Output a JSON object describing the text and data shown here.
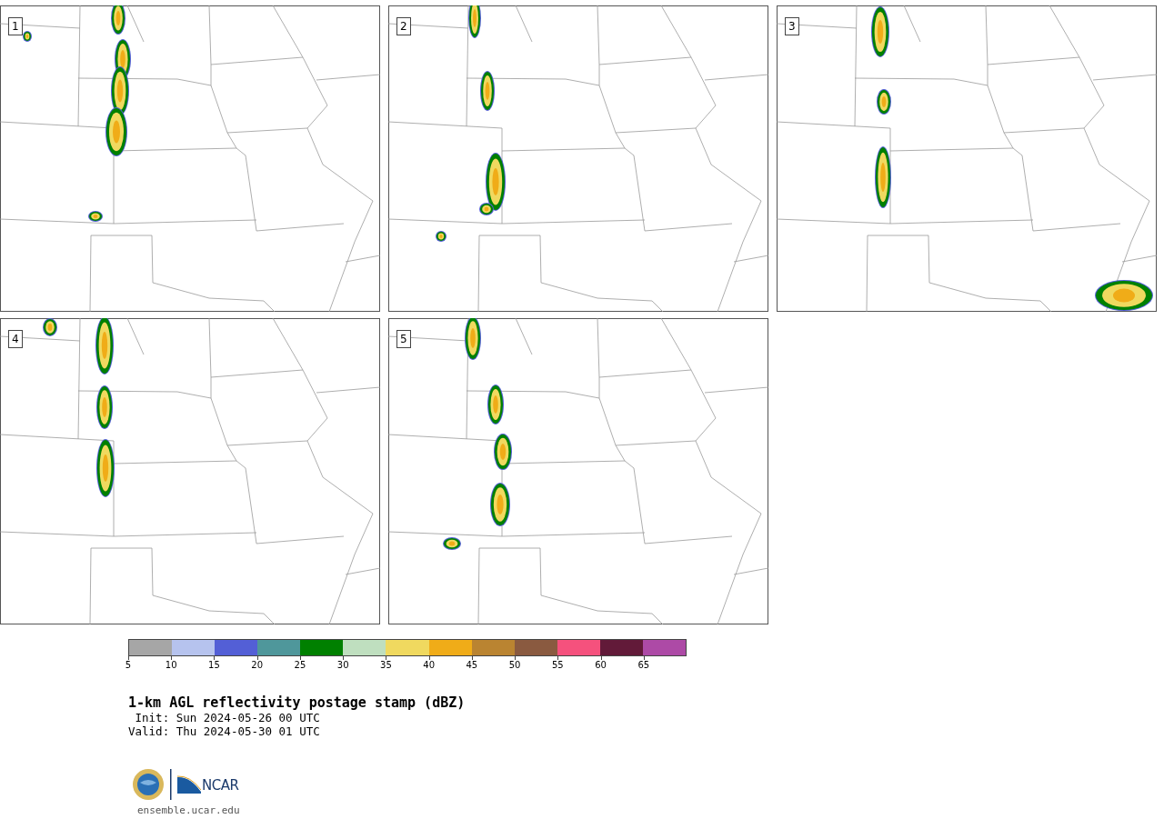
{
  "panels": [
    {
      "label": "1"
    },
    {
      "label": "2"
    },
    {
      "label": "3"
    },
    {
      "label": "4"
    },
    {
      "label": "5"
    }
  ],
  "colorbar": {
    "bins": [
      {
        "color": "#a6a6a6"
      },
      {
        "color": "#b6c3ee"
      },
      {
        "color": "#535fd6"
      },
      {
        "color": "#4f979b"
      },
      {
        "color": "#008000"
      },
      {
        "color": "#bfdfbf"
      },
      {
        "color": "#f0d95f"
      },
      {
        "color": "#f0ac18"
      },
      {
        "color": "#ba8431"
      },
      {
        "color": "#8a5a40"
      },
      {
        "color": "#f5517d"
      },
      {
        "color": "#621a39"
      },
      {
        "color": "#ad4aa6"
      }
    ],
    "ticks": [
      "5",
      "10",
      "15",
      "20",
      "25",
      "30",
      "35",
      "40",
      "45",
      "50",
      "55",
      "60",
      "65"
    ]
  },
  "title": "1-km AGL reflectivity postage stamp (dBZ)",
  "init": " Init: Sun 2024-05-26 00 UTC",
  "valid": "Valid: Thu 2024-05-30 01 UTC",
  "logo": {
    "text": "NCAR"
  },
  "url": "ensemble.ucar.edu"
}
